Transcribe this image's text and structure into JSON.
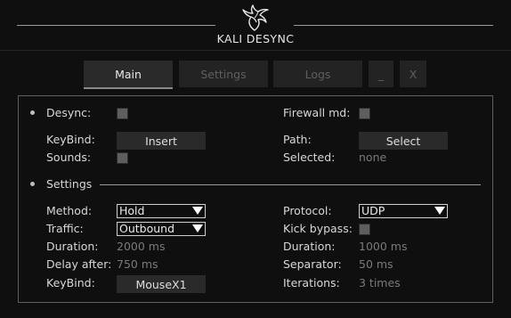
{
  "app": {
    "title": "KALI DESYNC",
    "logo_icon": "dragon-logo-icon"
  },
  "tabs": [
    {
      "label": "Main",
      "active": true
    },
    {
      "label": "Settings",
      "active": false
    },
    {
      "label": "Logs",
      "active": false
    }
  ],
  "window_controls": {
    "minimize": "_",
    "close": "X"
  },
  "main": {
    "desync_label": "Desync:",
    "desync_checked": false,
    "firewall_label": "Firewall md:",
    "firewall_checked": false,
    "keybind_label": "KeyBind:",
    "keybind_value": "Insert",
    "path_label": "Path:",
    "path_button": "Select",
    "sounds_label": "Sounds:",
    "sounds_checked": false,
    "selected_label": "Selected:",
    "selected_value": "none"
  },
  "settings": {
    "section_title": "Settings",
    "method_label": "Method:",
    "method_value": "Hold",
    "protocol_label": "Protocol:",
    "protocol_value": "UDP",
    "traffic_label": "Traffic:",
    "traffic_value": "Outbound",
    "kick_bypass_label": "Kick bypass:",
    "kick_bypass_checked": false,
    "duration_label": "Duration:",
    "duration_value": "2000 ms",
    "duration2_label": "Duration:",
    "duration2_value": "1000 ms",
    "delay_after_label": "Delay after:",
    "delay_after_value": "750 ms",
    "separator_label": "Separator:",
    "separator_value": "50 ms",
    "keybind_label": "KeyBind:",
    "keybind_value": "MouseX1",
    "iterations_label": "Iterations:",
    "iterations_value": "3 times"
  }
}
